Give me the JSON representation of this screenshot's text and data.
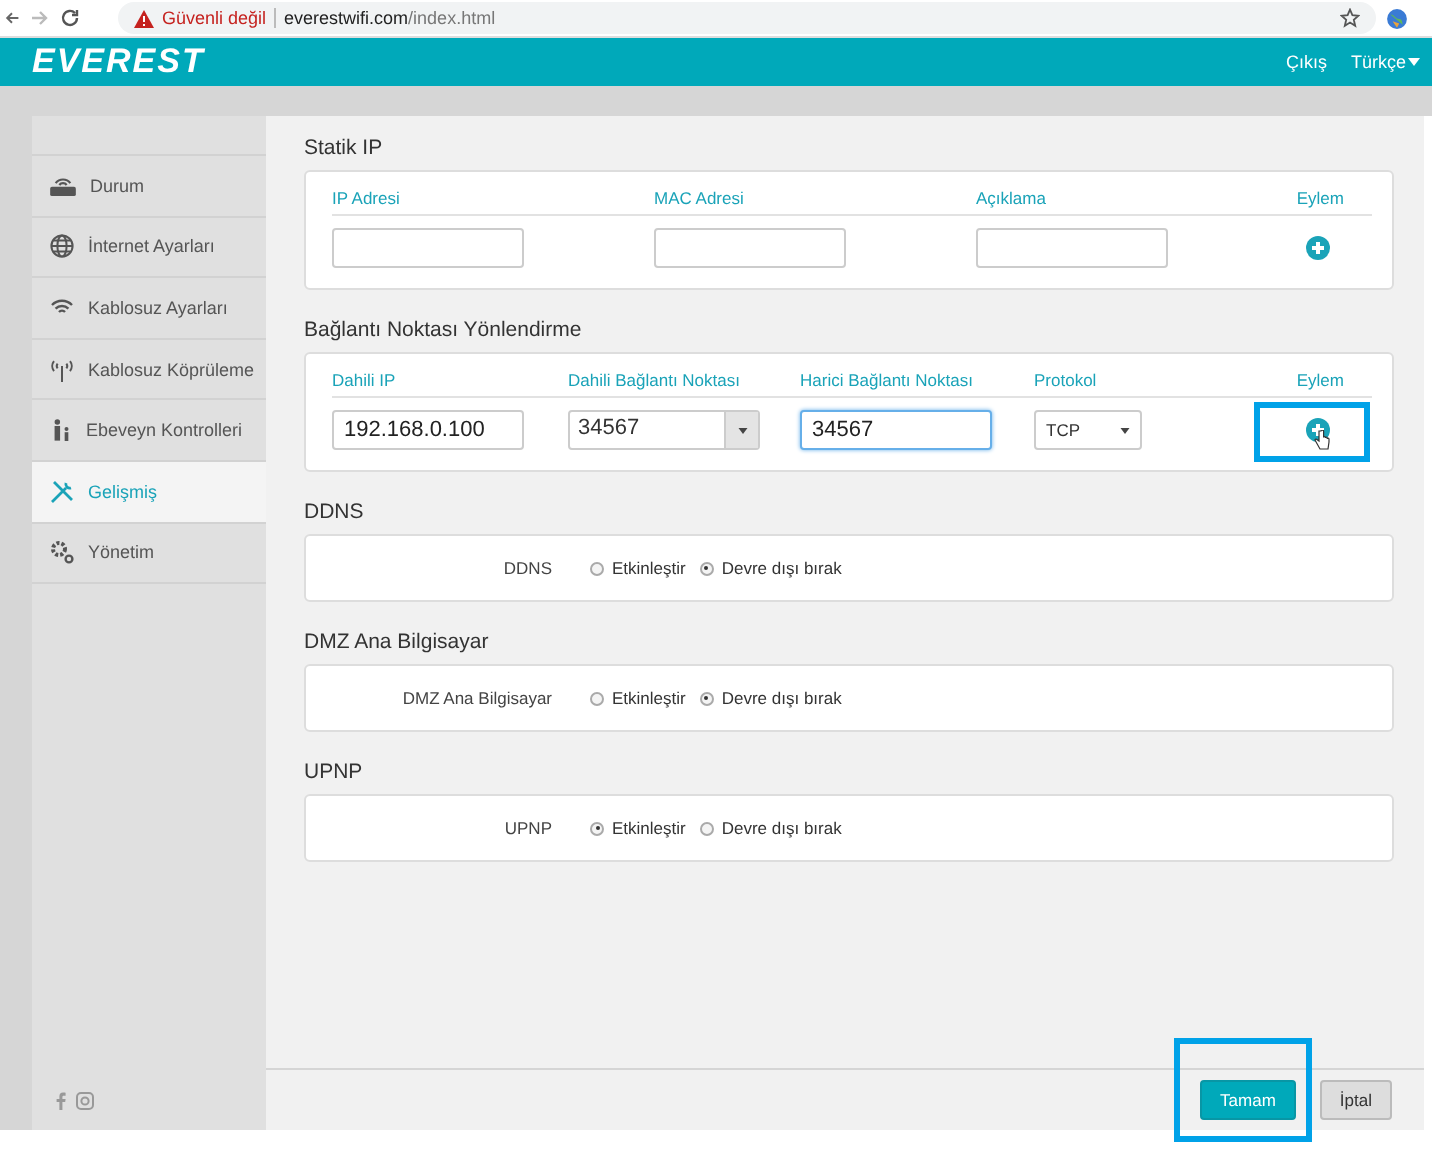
{
  "browser": {
    "security_warning": "Güvenli değil",
    "url_host": "everestwifi.com",
    "url_path": "/index.html"
  },
  "header": {
    "logo": "EVEREST",
    "links": [
      {
        "label": "Çıkış",
        "dropdown": false
      },
      {
        "label": "Türkçe",
        "dropdown": true
      }
    ]
  },
  "sidebar": {
    "items": [
      {
        "label": "Durum",
        "selected": false
      },
      {
        "label": "İnternet Ayarları",
        "selected": false
      },
      {
        "label": "Kablosuz Ayarları",
        "selected": false
      },
      {
        "label": "Kablosuz Köprüleme",
        "selected": false
      },
      {
        "label": "Ebeveyn Kontrolleri",
        "selected": false
      },
      {
        "label": "Gelişmiş",
        "selected": true
      },
      {
        "label": "Yönetim",
        "selected": false
      }
    ]
  },
  "static_ip": {
    "title": "Statik IP",
    "columns": [
      "IP Adresi",
      "MAC Adresi",
      "Açıklama",
      "Eylem"
    ]
  },
  "port_forwarding": {
    "title": "Bağlantı Noktası Yönlendirme",
    "columns": [
      "Dahili IP",
      "Dahili Bağlantı Noktası",
      "Harici Bağlantı Noktası",
      "Protokol",
      "Eylem"
    ],
    "fields": [
      {
        "kind": "text",
        "value": "192.168.0.100",
        "focused": false
      },
      {
        "kind": "combo",
        "value": "34567",
        "focused": false
      },
      {
        "kind": "text",
        "value": "34567",
        "focused": true
      },
      {
        "kind": "select",
        "value": "TCP",
        "focused": false
      }
    ],
    "add_highlighted": true
  },
  "toggles": [
    {
      "title": "DDNS",
      "label": "DDNS",
      "options": [
        {
          "label": "Etkinleştir",
          "selected": false
        },
        {
          "label": "Devre dışı bırak",
          "selected": true
        }
      ]
    },
    {
      "title": "DMZ Ana Bilgisayar",
      "label": "DMZ Ana Bilgisayar",
      "options": [
        {
          "label": "Etkinleştir",
          "selected": false
        },
        {
          "label": "Devre dışı bırak",
          "selected": true
        }
      ]
    },
    {
      "title": "UPNP",
      "label": "UPNP",
      "options": [
        {
          "label": "Etkinleştir",
          "selected": true
        },
        {
          "label": "Devre dışı bırak",
          "selected": false
        }
      ]
    }
  ],
  "buttons": [
    {
      "label": "Tamam",
      "kind": "primary",
      "highlighted": true
    },
    {
      "label": "İptal",
      "kind": "secondary",
      "highlighted": false
    }
  ]
}
